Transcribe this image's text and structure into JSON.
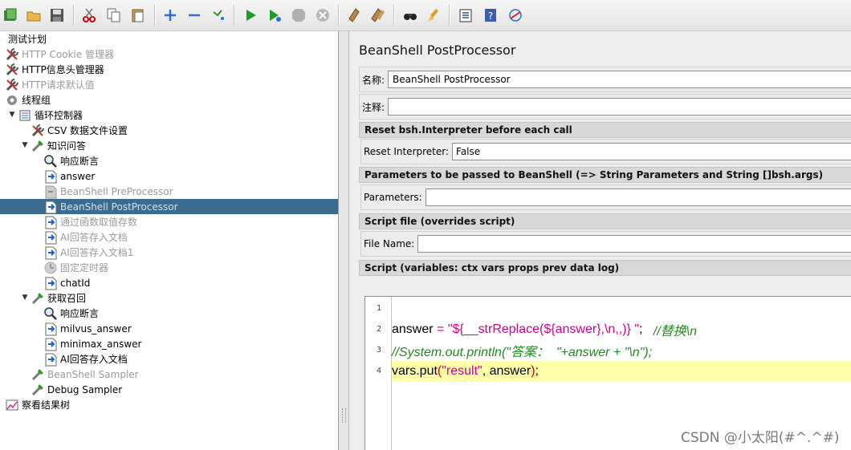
{
  "toolbar": {
    "icons": [
      "templates-icon",
      "open-icon",
      "save-icon",
      "cut-icon",
      "copy-icon",
      "paste-icon",
      "expand-icon",
      "collapse-icon",
      "toggle-icon",
      "start-icon",
      "start-no-pause-icon",
      "stop-icon",
      "shutdown-icon",
      "clear-icon",
      "clear-all-icon",
      "search-icon",
      "reset-search-icon",
      "function-helper-icon",
      "help-icon",
      "remote-icon"
    ]
  },
  "tree": {
    "nodes": [
      {
        "label": "测试计划",
        "icon": "test-plan-icon",
        "state": "normal"
      },
      {
        "label": "HTTP Cookie 管理器",
        "icon": "wrench-icon",
        "state": "disabled"
      },
      {
        "label": "HTTP信息头管理器",
        "icon": "wrench-icon",
        "state": "normal"
      },
      {
        "label": "HTTP请求默认值",
        "icon": "wrench-icon",
        "state": "disabled"
      },
      {
        "label": "线程组",
        "icon": "gear-icon",
        "state": "normal"
      },
      {
        "label": "循环控制器",
        "icon": "controller-icon",
        "state": "normal"
      },
      {
        "label": "CSV 数据文件设置",
        "icon": "wrench-icon",
        "state": "normal"
      },
      {
        "label": "知识问答",
        "icon": "sampler-icon",
        "state": "normal"
      },
      {
        "label": "响应断言",
        "icon": "magnifier-icon",
        "state": "normal"
      },
      {
        "label": "answer",
        "icon": "postprocessor-icon",
        "state": "normal"
      },
      {
        "label": "BeanShell PreProcessor",
        "icon": "preprocessor-icon",
        "state": "disabled"
      },
      {
        "label": "BeanShell PostProcessor",
        "icon": "postprocessor-icon",
        "state": "selected"
      },
      {
        "label": "通过函数取值存数",
        "icon": "postprocessor-icon",
        "state": "disabled"
      },
      {
        "label": "AI回答存入文档",
        "icon": "postprocessor-icon",
        "state": "disabled"
      },
      {
        "label": "AI回答存入文档1",
        "icon": "postprocessor-icon",
        "state": "disabled"
      },
      {
        "label": "固定定时器",
        "icon": "timer-icon",
        "state": "disabled"
      },
      {
        "label": "chatId",
        "icon": "postprocessor-icon",
        "state": "normal"
      },
      {
        "label": "获取召回",
        "icon": "sampler-icon",
        "state": "normal"
      },
      {
        "label": "响应断言",
        "icon": "magnifier-icon",
        "state": "normal"
      },
      {
        "label": "milvus_answer",
        "icon": "postprocessor-icon",
        "state": "normal"
      },
      {
        "label": "minimax_answer",
        "icon": "postprocessor-icon",
        "state": "normal"
      },
      {
        "label": "AI回答存入文档",
        "icon": "postprocessor-icon",
        "state": "normal"
      },
      {
        "label": "BeanShell Sampler",
        "icon": "sampler-icon",
        "state": "disabled"
      },
      {
        "label": "Debug Sampler",
        "icon": "sampler-icon",
        "state": "normal"
      },
      {
        "label": "察看结果树",
        "icon": "listener-icon",
        "state": "normal"
      }
    ]
  },
  "panel": {
    "title": "BeanShell PostProcessor",
    "name_label": "名称:",
    "name_value": "BeanShell PostProcessor",
    "comment_label": "注释:",
    "comment_value": "",
    "reset_section": "Reset bsh.Interpreter before each call",
    "reset_label": "Reset Interpreter:",
    "reset_value": "False",
    "params_section": "Parameters to be passed to BeanShell (=> String Parameters and String []bsh.args)",
    "params_label": "Parameters:",
    "params_value": "",
    "file_section": "Script file (overrides script)",
    "file_label": "File Name:",
    "file_value": "",
    "script_section": "Script (variables: ctx vars props prev data log)"
  },
  "editor": {
    "line_numbers": [
      "1",
      "2",
      "3",
      "4"
    ],
    "lines": [
      [],
      [
        {
          "t": "answer ",
          "c": "k"
        },
        {
          "t": "= ",
          "c": "s"
        },
        {
          "t": "\"${__strReplace(${answer},\\n,,)} \"",
          "c": "s"
        },
        {
          "t": ";   ",
          "c": "o"
        },
        {
          "t": "//替换\\n",
          "c": "c"
        }
      ],
      [
        {
          "t": "//System.out.println(\"答案：  \"+answer + \"\\n\");",
          "c": "c"
        }
      ],
      [
        {
          "t": "vars.put",
          "c": "k"
        },
        {
          "t": "(",
          "c": "r"
        },
        {
          "t": "\"result\"",
          "c": "s"
        },
        {
          "t": ", answer",
          "c": "k"
        },
        {
          "t": ")",
          "c": "r"
        },
        {
          "t": ";",
          "c": "k"
        }
      ]
    ],
    "highlighted_line": 4
  },
  "watermark": "CSDN @小太阳(#^.^#)"
}
